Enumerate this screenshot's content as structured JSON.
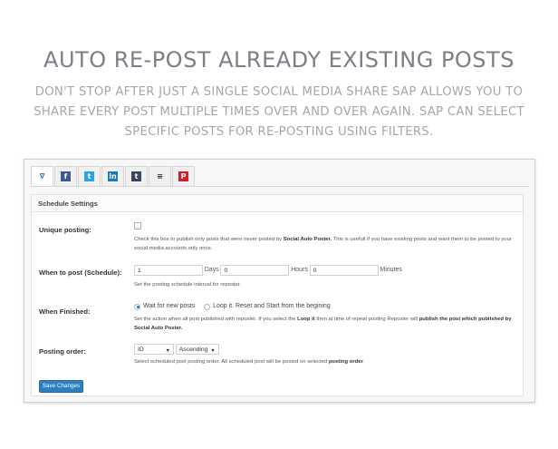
{
  "hero": {
    "title": "AUTO RE-POST ALREADY EXISTING POSTS",
    "description": "DON'T STOP AFTER JUST A SINGLE SOCIAL MEDIA SHARE SAP ALLOWS YOU TO SHARE EVERY POST MULTIPLE TIMES OVER AND OVER AGAIN. SAP CAN SELECT SPECIFIC POSTS FOR RE-POSTING USING FILTERS."
  },
  "tabs": [
    {
      "name": "tab-general",
      "icon": "wpw-logo-icon",
      "glyph": "∇",
      "bg": "#ffffff",
      "fg": "#2a6fbd"
    },
    {
      "name": "tab-facebook",
      "icon": "facebook-icon",
      "glyph": "f",
      "bg": "#3b5998",
      "fg": "#ffffff"
    },
    {
      "name": "tab-twitter",
      "icon": "twitter-icon",
      "glyph": "t",
      "bg": "#2aa3e0",
      "fg": "#ffffff"
    },
    {
      "name": "tab-linkedin",
      "icon": "linkedin-icon",
      "glyph": "in",
      "bg": "#1d79b5",
      "fg": "#ffffff"
    },
    {
      "name": "tab-tumblr",
      "icon": "tumblr-icon",
      "glyph": "t",
      "bg": "#36465d",
      "fg": "#ffffff"
    },
    {
      "name": "tab-buffer",
      "icon": "buffer-icon",
      "glyph": "≡",
      "bg": "#f0f0f0",
      "fg": "#333333"
    },
    {
      "name": "tab-pinterest",
      "icon": "pinterest-icon",
      "glyph": "P",
      "bg": "#cb2027",
      "fg": "#ffffff"
    }
  ],
  "settings": {
    "header": "Schedule Settings",
    "unique_posting": {
      "label": "Unique posting:",
      "checked": false,
      "desc_1": "Check this box to publish only posts that were never posted by ",
      "desc_bold": "Social Auto Poster.",
      "desc_2": " This is usefull if you have existing posts and want them to be posted to your social media accounts only once."
    },
    "when_to_post": {
      "label": "When to post (Schedule):",
      "days_value": "1",
      "days_label": "Days",
      "hours_value": "0",
      "hours_label": "Hours",
      "minutes_value": "0",
      "minutes_label": "Minutes",
      "desc": "Set the posting schedule interval for reposter."
    },
    "when_finished": {
      "label": "When Finished:",
      "option_1": "Wait for new posts",
      "option_2": "Loop it. Reset and Start from the begining",
      "selected": "option_1",
      "desc_1": "Set the action when all post published with reposter. If you select the ",
      "desc_bold_1": "Loop it",
      "desc_2": " then at time of repeat posting Reposter will ",
      "desc_bold_2": "publish the post which published by Social Auto Poster."
    },
    "posting_order": {
      "label": "Posting order:",
      "orderby_value": "ID",
      "order_value": "Ascending",
      "desc_1": "Select scheduled post posting order. All scheduled post will be posted on selected ",
      "desc_bold": "posting order",
      "desc_2": "."
    },
    "save_label": "Save Changes"
  },
  "colors": {
    "accent": "#2a80c0",
    "title": "#7a8088",
    "subtitle": "#a2a7ad"
  }
}
